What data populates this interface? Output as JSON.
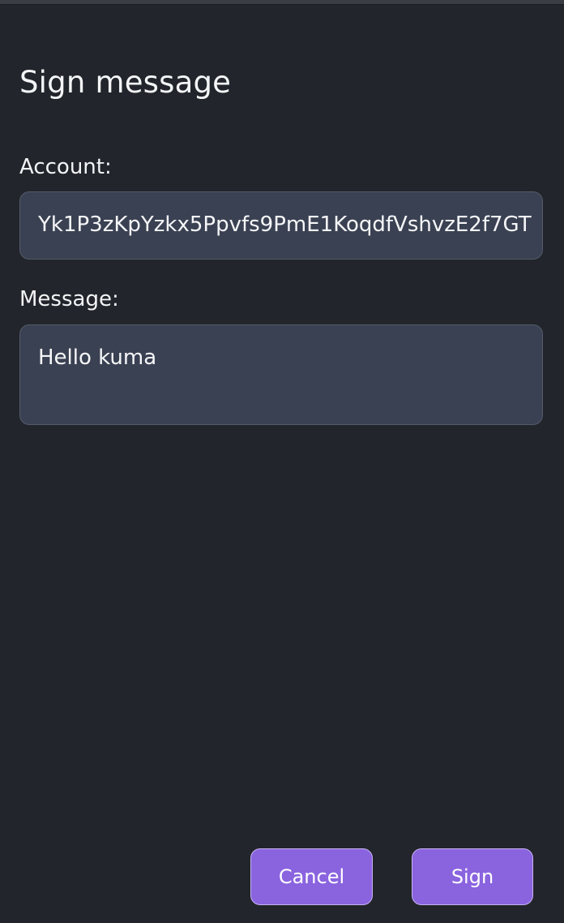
{
  "dialog": {
    "title": "Sign message"
  },
  "account": {
    "label": "Account:",
    "value": "Yk1P3zKpYzkx5Ppvfs9PmE1KoqdfVshvzE2f7GT"
  },
  "message": {
    "label": "Message:",
    "value": "Hello kuma"
  },
  "actions": {
    "cancel_label": "Cancel",
    "sign_label": "Sign"
  },
  "colors": {
    "background": "#22252b",
    "field_background": "#3a4152",
    "field_border": "#545b6b",
    "button_primary": "#8a63df",
    "button_border": "#c6b3f2",
    "text": "#f3f4f6"
  }
}
